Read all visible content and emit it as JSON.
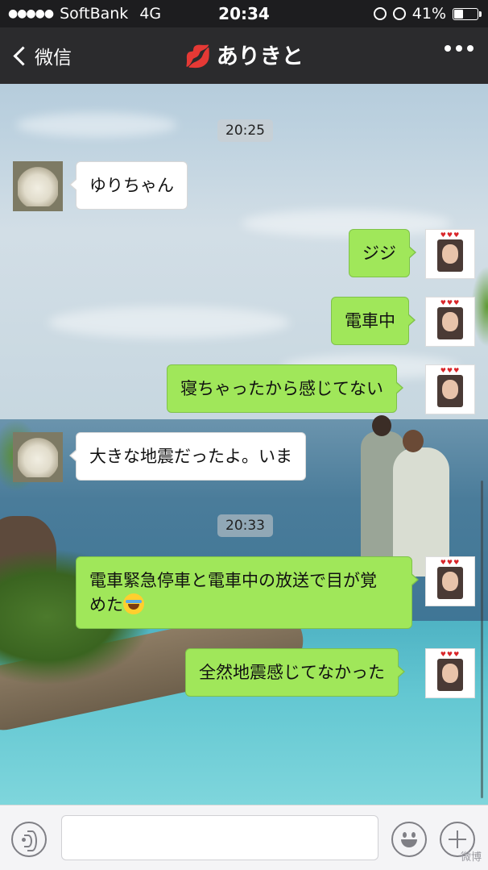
{
  "status_bar": {
    "signal": "●●●●●",
    "carrier": "SoftBank",
    "network": "4G",
    "time": "20:34",
    "battery_percent": "41%",
    "battery_level": 0.41
  },
  "nav": {
    "back_label": "微信",
    "title_icon": "💋",
    "title": "ありきと"
  },
  "messages": [
    {
      "type": "time",
      "text": "20:25"
    },
    {
      "type": "in",
      "text": "ゆりちゃん",
      "avatar": "flower-avatar"
    },
    {
      "type": "out",
      "text": "ジジ",
      "avatar": "self-avatar"
    },
    {
      "type": "out",
      "text": "電車中",
      "avatar": "self-avatar"
    },
    {
      "type": "out",
      "text": "寝ちゃったから感じてない",
      "avatar": "self-avatar"
    },
    {
      "type": "in",
      "text": "大きな地震だったよ。いま",
      "avatar": "flower-avatar"
    },
    {
      "type": "time",
      "text": "20:33"
    },
    {
      "type": "out",
      "text_line1": "電車緊急停車と電車中の放送で目が覚",
      "text_line2": "めた",
      "emoji": "tears-of-joy-emoji",
      "avatar": "self-avatar"
    },
    {
      "type": "out",
      "text": "全然地震感じてなかった",
      "avatar": "self-avatar"
    }
  ],
  "input_bar": {
    "placeholder": "",
    "value": ""
  },
  "watermark": "微博",
  "colors": {
    "outgoing_bubble": "#a0e75a",
    "incoming_bubble": "#ffffff",
    "nav_background": "#2b2b2d"
  }
}
